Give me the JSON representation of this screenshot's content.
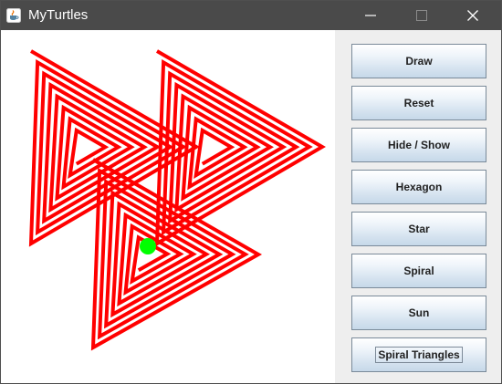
{
  "window": {
    "title": "MyTurtles",
    "app_icon": "java-cup-icon",
    "controls": [
      "minimize-icon",
      "maximize-icon",
      "close-icon"
    ]
  },
  "canvas": {
    "background": "#ffffff",
    "line_color": "#ff0000",
    "turtle_color": "#00ff00",
    "drawing": "spiral-triangles"
  },
  "buttons": [
    {
      "label": "Draw"
    },
    {
      "label": "Reset"
    },
    {
      "label": "Hide / Show"
    },
    {
      "label": "Hexagon"
    },
    {
      "label": "Star"
    },
    {
      "label": "Spiral"
    },
    {
      "label": "Sun"
    },
    {
      "label": "Spiral Triangles",
      "focused": true
    }
  ]
}
